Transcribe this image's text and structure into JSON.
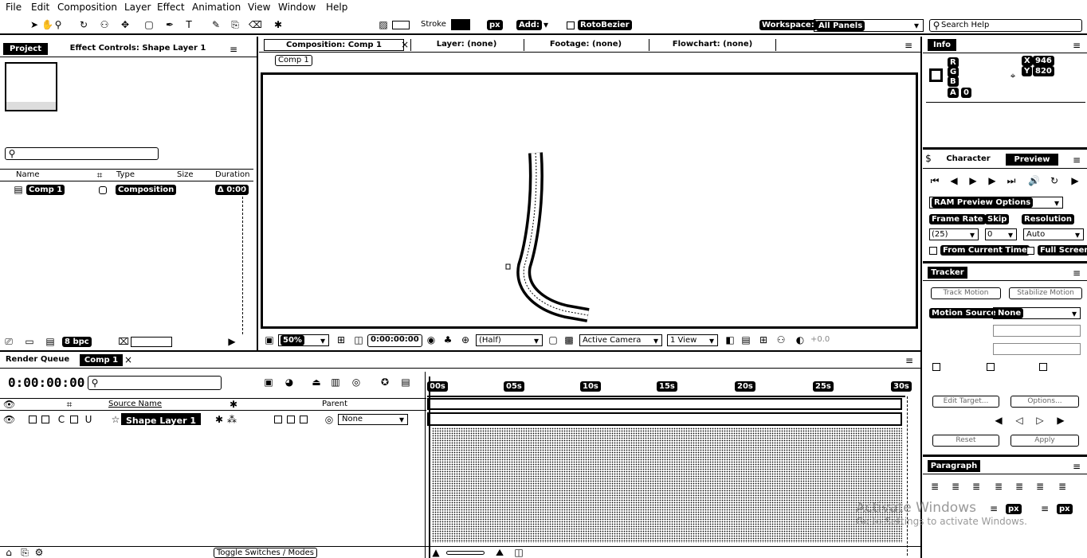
{
  "menu": [
    "File",
    "Edit",
    "Composition",
    "Layer",
    "Effect",
    "Animation",
    "View",
    "Window",
    "Help"
  ],
  "toolbar": {
    "stroke_label": "Stroke",
    "stroke_px": "px",
    "add_label": "Add:",
    "rotobezier_label": "RotoBezier",
    "workspace_label": "Workspace:",
    "workspace_value": "All Panels",
    "search_placeholder": "Search Help"
  },
  "project_panel": {
    "tabs": [
      "Project",
      "Effect Controls: Shape Layer 1"
    ],
    "search_placeholder": "",
    "columns": [
      "Name",
      "Type",
      "Size",
      "Duration"
    ],
    "rows": [
      {
        "name": "Comp 1",
        "type": "Composition",
        "duration": "Δ 0:00"
      }
    ],
    "bpc": "8 bpc"
  },
  "viewer": {
    "tabs": [
      "Composition: Comp 1",
      "Layer: (none)",
      "Footage: (none)",
      "Flowchart: (none)"
    ],
    "breadcrumb": "Comp 1",
    "zoom": "50%",
    "timecode": "0:00:00:00",
    "resolution": "(Half)",
    "camera": "Active Camera",
    "views": "1 View"
  },
  "info_panel": {
    "tab": "Info",
    "r": "R",
    "g": "G",
    "b": "B",
    "a": "A",
    "a_val": "0",
    "x_label": "X",
    "x_val": "946",
    "y_label": "Y",
    "y_val": "820"
  },
  "preview_panel": {
    "tabs": [
      "Character",
      "Preview"
    ],
    "ram_options": "RAM Preview Options",
    "frame_rate_label": "Frame Rate",
    "skip_label": "Skip",
    "resolution_label": "Resolution",
    "frame_rate": "(25)",
    "skip": "0",
    "resolution": "Auto",
    "from_current": "From Current Time",
    "full_screen": "Full Screen"
  },
  "tracker_panel": {
    "tab": "Tracker",
    "track_motion": "Track Motion",
    "stabilize_motion": "Stabilize Motion",
    "motion_source_label": "Motion Source:",
    "motion_source": "None",
    "edit_target": "Edit Target...",
    "options": "Options...",
    "reset": "Reset",
    "apply": "Apply"
  },
  "paragraph_panel": {
    "tab": "Paragraph",
    "px1": "px",
    "px2": "px"
  },
  "timeline": {
    "tabs": [
      "Render Queue",
      "Comp 1"
    ],
    "timecode": "0:00:00:00",
    "col_source": "Source Name",
    "col_parent": "Parent",
    "layer_name": "Shape Layer 1",
    "parent_value": "None",
    "ruler": [
      "00s",
      "05s",
      "10s",
      "15s",
      "20s",
      "25s",
      "30s"
    ],
    "toggle": "Toggle Switches / Modes"
  },
  "watermark": {
    "line1": "Activate Windows",
    "line2": "Go to Settings to activate Windows."
  }
}
